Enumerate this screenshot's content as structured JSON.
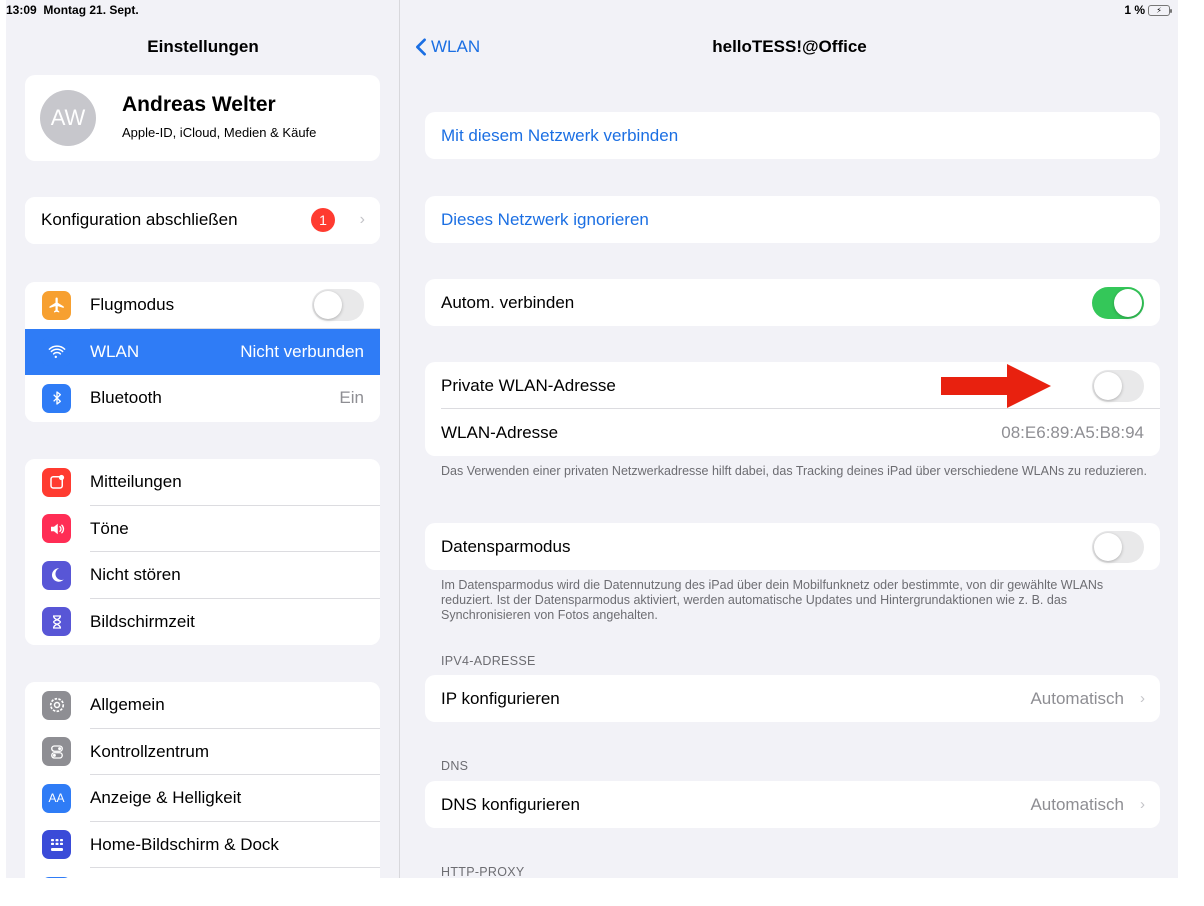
{
  "status": {
    "time": "13:09",
    "date": "Montag 21. Sept.",
    "battery": "1 %"
  },
  "sidebar": {
    "title": "Einstellungen",
    "profile": {
      "initials": "AW",
      "name": "Andreas Welter",
      "subtitle": "Apple-ID, iCloud, Medien & Käufe"
    },
    "config": {
      "label": "Konfiguration abschließen",
      "badge": "1"
    },
    "group1": [
      {
        "label": "Flugmodus",
        "icon": "airplane-icon",
        "color": "#f7a030",
        "toggle": false
      },
      {
        "label": "WLAN",
        "icon": "wifi-icon",
        "color": "#2f7cf6",
        "value": "Nicht verbunden",
        "selected": true
      },
      {
        "label": "Bluetooth",
        "icon": "bluetooth-icon",
        "color": "#2f7cf6",
        "value": "Ein"
      }
    ],
    "group2": [
      {
        "label": "Mitteilungen",
        "icon": "notifications-icon",
        "color": "#ff3b30"
      },
      {
        "label": "Töne",
        "icon": "sounds-icon",
        "color": "#ff2d55"
      },
      {
        "label": "Nicht stören",
        "icon": "moon-icon",
        "color": "#5856d6"
      },
      {
        "label": "Bildschirmzeit",
        "icon": "hourglass-icon",
        "color": "#5856d6"
      }
    ],
    "group3": [
      {
        "label": "Allgemein",
        "icon": "gear-icon",
        "color": "#8e8e93"
      },
      {
        "label": "Kontrollzentrum",
        "icon": "control-center-icon",
        "color": "#8e8e93"
      },
      {
        "label": "Anzeige & Helligkeit",
        "icon": "display-icon",
        "color": "#2f7cf6"
      },
      {
        "label": "Home-Bildschirm & Dock",
        "icon": "home-screen-icon",
        "color": "#3a4bd8"
      }
    ]
  },
  "detail": {
    "back_label": "WLAN",
    "title": "helloTESS!@Office",
    "connect_label": "Mit diesem Netzwerk verbinden",
    "forget_label": "Dieses Netzwerk ignorieren",
    "auto_join": {
      "label": "Autom. verbinden",
      "on": true
    },
    "private_address": {
      "label": "Private WLAN-Adresse",
      "on": false
    },
    "wlan_address": {
      "label": "WLAN-Adresse",
      "value": "08:E6:89:A5:B8:94"
    },
    "private_note": "Das Verwenden einer privaten Netzwerkadresse hilft dabei, das Tracking deines iPad über verschiedene WLANs zu reduzieren.",
    "low_data": {
      "label": "Datensparmodus",
      "on": false
    },
    "low_data_note": "Im Datensparmodus wird die Datennutzung des iPad über dein Mobilfunknetz oder bestimmte, von dir gewählte WLANs reduziert. Ist der Datensparmodus aktiviert, werden automatische Updates und Hintergrundaktionen wie z. B. das Synchronisieren von Fotos angehalten.",
    "ipv4_header": "IPV4-ADRESSE",
    "ip_config": {
      "label": "IP konfigurieren",
      "value": "Automatisch"
    },
    "dns_header": "DNS",
    "dns_config": {
      "label": "DNS konfigurieren",
      "value": "Automatisch"
    },
    "proxy_header": "HTTP-PROXY"
  },
  "colors": {
    "accent": "#1b6fe3",
    "switch_on": "#34c759",
    "badge": "#ff3b30",
    "annotation_arrow": "#e8210f"
  }
}
